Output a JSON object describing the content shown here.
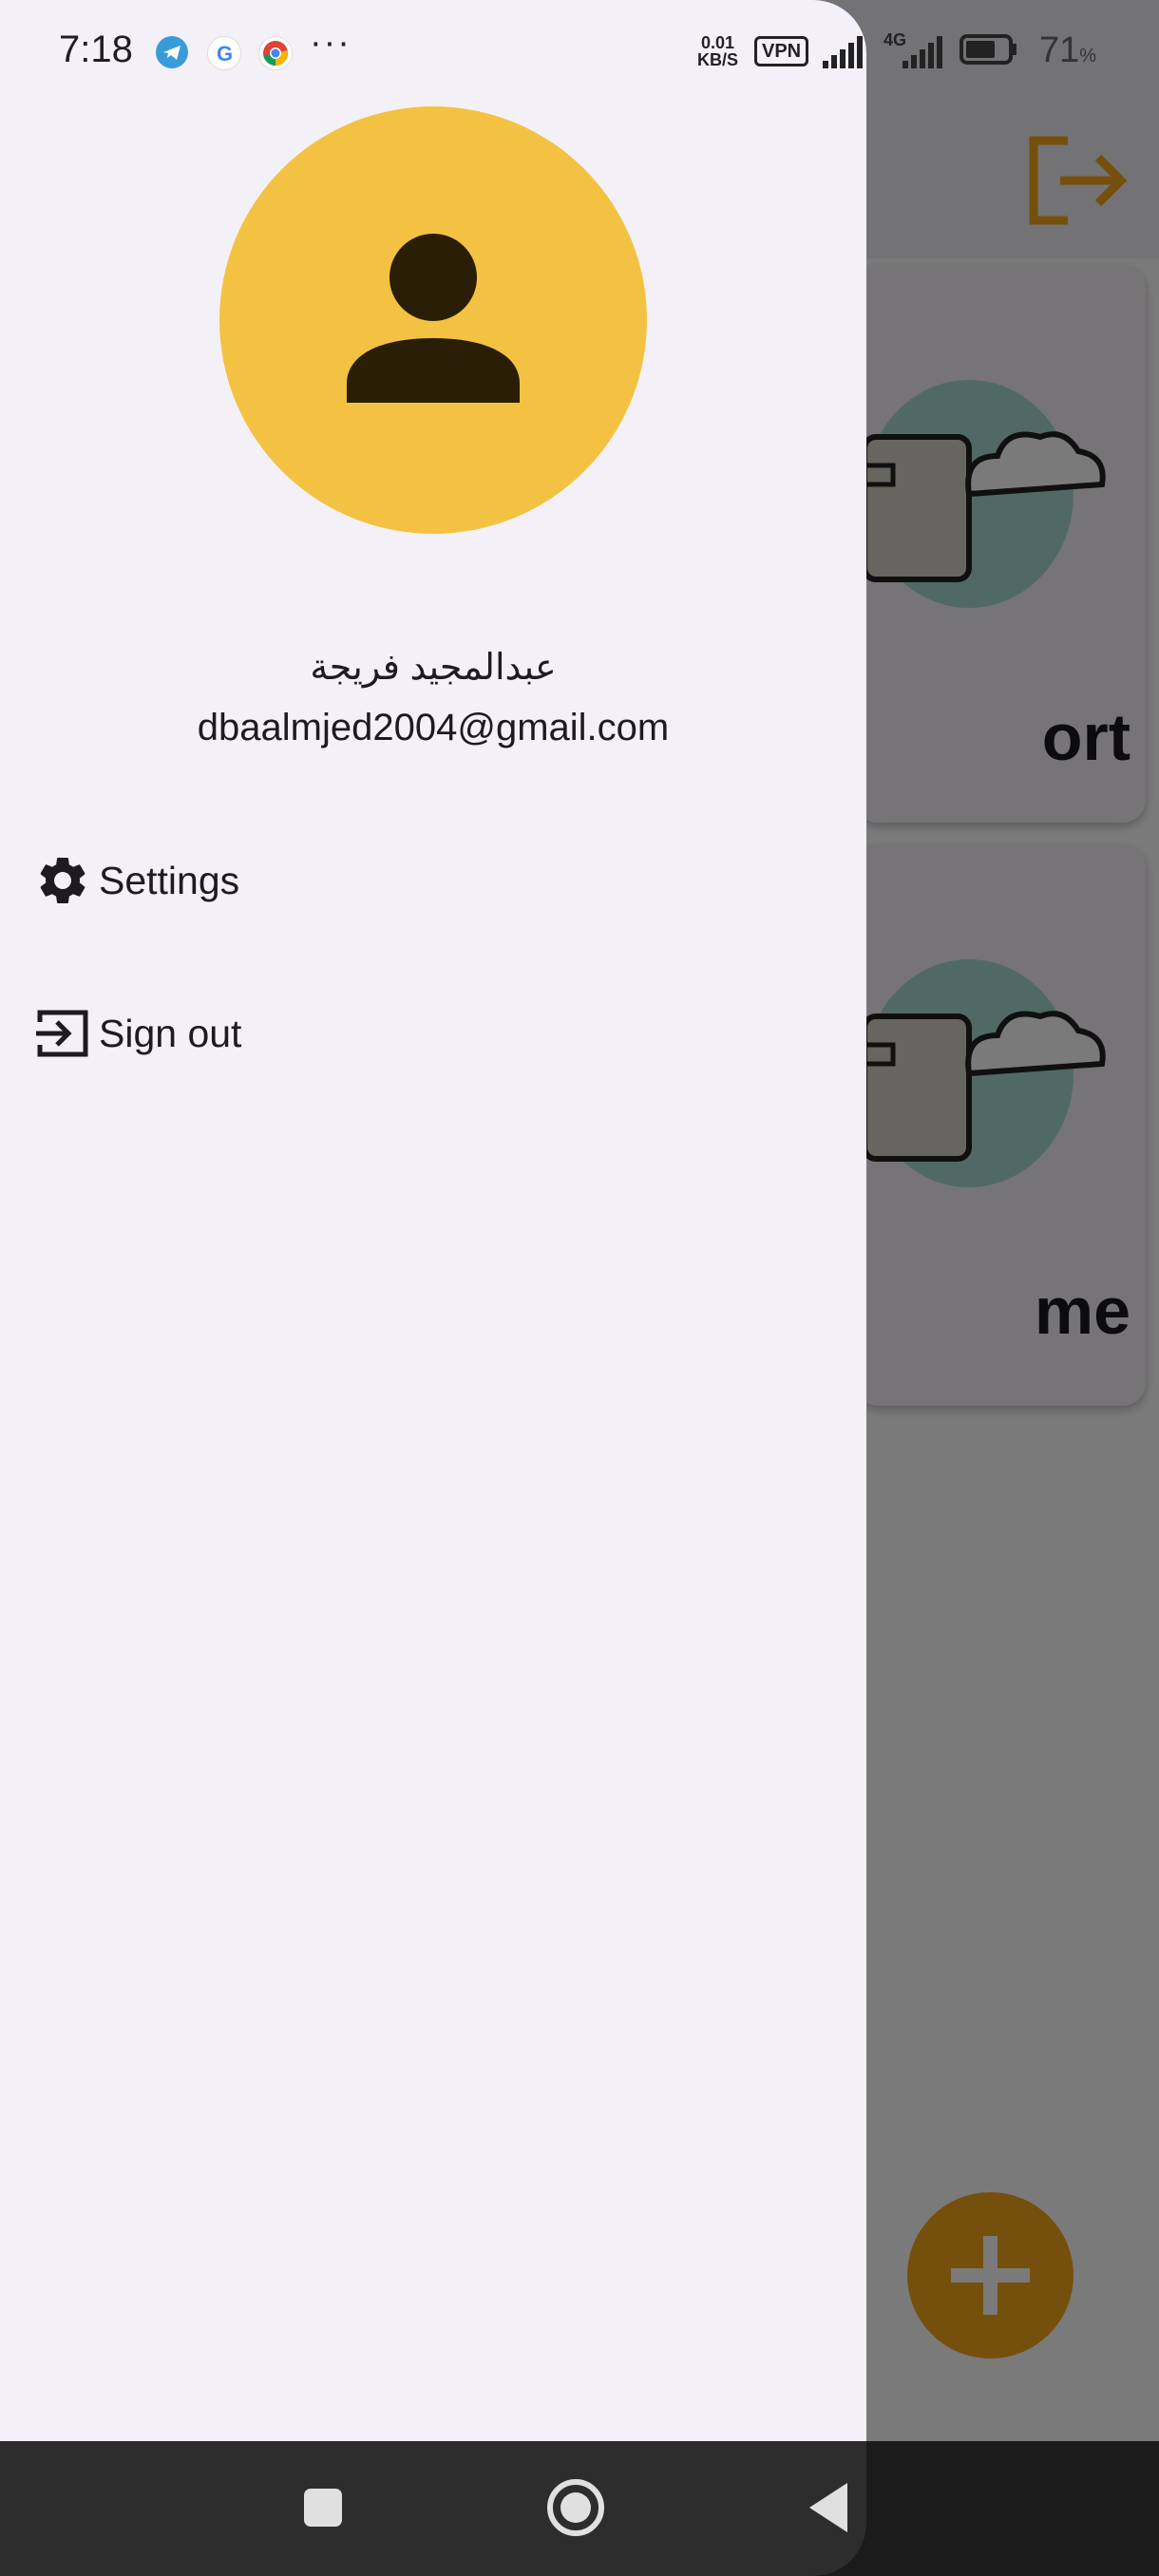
{
  "status_bar": {
    "time": "7:18",
    "notification_icons": [
      "telegram-icon",
      "google-icon",
      "chrome-icon"
    ],
    "more_indicator": "···",
    "net_speed_value": "0.01",
    "net_speed_unit": "KB/S",
    "vpn_label": "VPN",
    "network_type": "4G",
    "battery_percent": "71",
    "battery_unit": "%",
    "battery_level": 0.71
  },
  "background_app": {
    "cards": [
      {
        "label_visible": "ort"
      },
      {
        "label_visible": "me"
      }
    ],
    "colors": {
      "accent": "#f4a51a",
      "card_art_blob": "#a8dcd1"
    }
  },
  "drawer": {
    "avatar_color": "#f4c242",
    "user_name": "عبدالمجيد فريجة",
    "user_email": "dbaalmjed2004@gmail.com",
    "menu": [
      {
        "icon": "gear-icon",
        "label": "Settings"
      },
      {
        "icon": "sign-in-icon",
        "label": "Sign out"
      }
    ]
  },
  "nav_bar": {
    "buttons": [
      "recents-button",
      "home-button",
      "back-button"
    ]
  }
}
